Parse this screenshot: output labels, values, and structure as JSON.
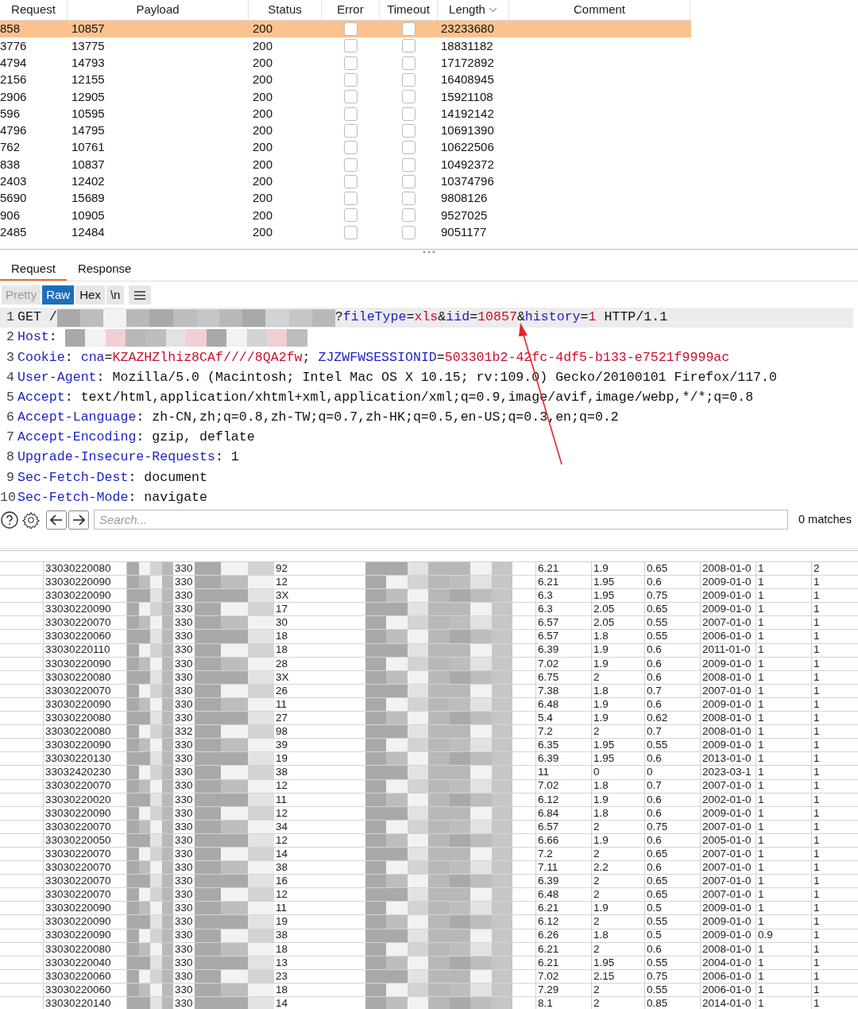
{
  "results_table": {
    "columns": [
      {
        "label": "Request",
        "sorted": false
      },
      {
        "label": "Payload",
        "sorted": false
      },
      {
        "label": "Status",
        "sorted": false
      },
      {
        "label": "Error",
        "sorted": false
      },
      {
        "label": "Timeout",
        "sorted": false
      },
      {
        "label": "Length",
        "sorted": true
      },
      {
        "label": "Comment",
        "sorted": false
      }
    ],
    "rows": [
      {
        "cells": [
          "858",
          "10857",
          "200",
          "23233680"
        ],
        "error": false,
        "timeout": false,
        "selected": true
      },
      {
        "cells": [
          "3776",
          "13775",
          "200",
          "18831182"
        ],
        "error": false,
        "timeout": false,
        "selected": false
      },
      {
        "cells": [
          "4794",
          "14793",
          "200",
          "17172892"
        ],
        "error": false,
        "timeout": false,
        "selected": false
      },
      {
        "cells": [
          "2156",
          "12155",
          "200",
          "16408945"
        ],
        "error": false,
        "timeout": false,
        "selected": false
      },
      {
        "cells": [
          "2906",
          "12905",
          "200",
          "15921108"
        ],
        "error": false,
        "timeout": false,
        "selected": false
      },
      {
        "cells": [
          "596",
          "10595",
          "200",
          "14192142"
        ],
        "error": false,
        "timeout": false,
        "selected": false
      },
      {
        "cells": [
          "4796",
          "14795",
          "200",
          "10691390"
        ],
        "error": false,
        "timeout": false,
        "selected": false
      },
      {
        "cells": [
          "762",
          "10761",
          "200",
          "10622506"
        ],
        "error": false,
        "timeout": false,
        "selected": false
      },
      {
        "cells": [
          "838",
          "10837",
          "200",
          "10492372"
        ],
        "error": false,
        "timeout": false,
        "selected": false
      },
      {
        "cells": [
          "2403",
          "12402",
          "200",
          "10374796"
        ],
        "error": false,
        "timeout": false,
        "selected": false
      },
      {
        "cells": [
          "5690",
          "15689",
          "200",
          "9808126"
        ],
        "error": false,
        "timeout": false,
        "selected": false
      },
      {
        "cells": [
          "906",
          "10905",
          "200",
          "9527025"
        ],
        "error": false,
        "timeout": false,
        "selected": false
      },
      {
        "cells": [
          "2485",
          "12484",
          "200",
          "9051177"
        ],
        "error": false,
        "timeout": false,
        "selected": false
      }
    ]
  },
  "message_tabs": [
    {
      "label": "Request",
      "selected": true
    },
    {
      "label": "Response",
      "selected": false
    }
  ],
  "view_buttons": [
    {
      "kind": "text",
      "label": "Pretty",
      "selected": false
    },
    {
      "kind": "text",
      "label": "Raw",
      "selected": true
    },
    {
      "kind": "text",
      "label": "Hex",
      "selected": false
    },
    {
      "kind": "text",
      "label": "\\n",
      "selected": false
    },
    {
      "kind": "menu",
      "selected": false
    }
  ],
  "request_lines": [
    {
      "number": "1",
      "highlighted": true,
      "segments": [
        {
          "kind": "plain",
          "text": "GET /"
        },
        {
          "kind": "redacted"
        },
        {
          "kind": "plain",
          "text": "?"
        },
        {
          "kind": "name",
          "text": "fileType"
        },
        {
          "kind": "plain",
          "text": "="
        },
        {
          "kind": "value",
          "text": "xls"
        },
        {
          "kind": "plain",
          "text": "&"
        },
        {
          "kind": "name",
          "text": "iid"
        },
        {
          "kind": "plain",
          "text": "="
        },
        {
          "kind": "value",
          "text": "10857"
        },
        {
          "kind": "plain",
          "text": "&"
        },
        {
          "kind": "name",
          "text": "history"
        },
        {
          "kind": "plain",
          "text": "="
        },
        {
          "kind": "value",
          "text": "1"
        },
        {
          "kind": "plain",
          "text": " HTTP/1.1"
        }
      ]
    },
    {
      "number": "2",
      "highlighted": false,
      "segments": [
        {
          "kind": "name",
          "text": "Host"
        },
        {
          "kind": "plain",
          "text": ": "
        },
        {
          "kind": "redacted"
        }
      ]
    },
    {
      "number": "3",
      "highlighted": false,
      "segments": [
        {
          "kind": "name",
          "text": "Cookie"
        },
        {
          "kind": "plain",
          "text": ": "
        },
        {
          "kind": "name",
          "text": "cna"
        },
        {
          "kind": "plain",
          "text": "="
        },
        {
          "kind": "value",
          "text": "KZAZHZlhiz8CAf////8QA2fw"
        },
        {
          "kind": "plain",
          "text": "; "
        },
        {
          "kind": "name",
          "text": "ZJZWFWSESSIONID"
        },
        {
          "kind": "plain",
          "text": "="
        },
        {
          "kind": "value",
          "text": "503301b2-42fc-4df5-b133-e7521f9999ac"
        }
      ]
    },
    {
      "number": "4",
      "highlighted": false,
      "segments": [
        {
          "kind": "name",
          "text": "User-Agent"
        },
        {
          "kind": "plain",
          "text": ": Mozilla/5.0 (Macintosh; Intel Mac OS X 10.15; rv:109.0) Gecko/20100101 Firefox/117.0"
        }
      ]
    },
    {
      "number": "5",
      "highlighted": false,
      "segments": [
        {
          "kind": "name",
          "text": "Accept"
        },
        {
          "kind": "plain",
          "text": ": text/html,application/xhtml+xml,application/xml;q=0.9,image/avif,image/webp,*/*;q=0.8"
        }
      ]
    },
    {
      "number": "6",
      "highlighted": false,
      "segments": [
        {
          "kind": "name",
          "text": "Accept-Language"
        },
        {
          "kind": "plain",
          "text": ": zh-CN,zh;q=0.8,zh-TW;q=0.7,zh-HK;q=0.5,en-US;q=0.3,en;q=0.2"
        }
      ]
    },
    {
      "number": "7",
      "highlighted": false,
      "segments": [
        {
          "kind": "name",
          "text": "Accept-Encoding"
        },
        {
          "kind": "plain",
          "text": ": gzip, deflate"
        }
      ]
    },
    {
      "number": "8",
      "highlighted": false,
      "segments": [
        {
          "kind": "name",
          "text": "Upgrade-Insecure-Requests"
        },
        {
          "kind": "plain",
          "text": ": 1"
        }
      ]
    },
    {
      "number": "9",
      "highlighted": false,
      "segments": [
        {
          "kind": "name",
          "text": "Sec-Fetch-Dest"
        },
        {
          "kind": "plain",
          "text": ": document"
        }
      ]
    },
    {
      "number": "10",
      "highlighted": false,
      "segments": [
        {
          "kind": "name",
          "text": "Sec-Fetch-Mode"
        },
        {
          "kind": "plain",
          "text": ": navigate"
        }
      ]
    }
  ],
  "search": {
    "placeholder": "Search...",
    "matches": "0 matches"
  },
  "spreadsheet_rows": [
    [
      "33030220080",
      "330",
      "92",
      "6.21",
      "1.9",
      "0.65",
      "2008-01-0",
      "1",
      "2"
    ],
    [
      "33030220090",
      "330",
      "12",
      "6.21",
      "1.95",
      "0.6",
      "2009-01-0",
      "1",
      "1"
    ],
    [
      "33030220090",
      "330",
      "3X",
      "6.3",
      "1.95",
      "0.75",
      "2009-01-0",
      "1",
      "1"
    ],
    [
      "33030220090",
      "330",
      "17",
      "6.3",
      "2.05",
      "0.65",
      "2009-01-0",
      "1",
      "1"
    ],
    [
      "33030220070",
      "330",
      "30",
      "6.57",
      "2.05",
      "0.55",
      "2007-01-0",
      "1",
      "1"
    ],
    [
      "33030220060",
      "330",
      "18",
      "6.57",
      "1.8",
      "0.55",
      "2006-01-0",
      "1",
      "1"
    ],
    [
      "33030220110",
      "330",
      "18",
      "6.39",
      "1.9",
      "0.6",
      "2011-01-0",
      "1",
      "1"
    ],
    [
      "33030220090",
      "330",
      "28",
      "7.02",
      "1.9",
      "0.6",
      "2009-01-0",
      "1",
      "1"
    ],
    [
      "33030220080",
      "330",
      "3X",
      "6.75",
      "2",
      "0.6",
      "2008-01-0",
      "1",
      "1"
    ],
    [
      "33030220070",
      "330",
      "26",
      "7.38",
      "1.8",
      "0.7",
      "2007-01-0",
      "1",
      "1"
    ],
    [
      "33030220090",
      "330",
      "11",
      "6.48",
      "1.9",
      "0.6",
      "2009-01-0",
      "1",
      "1"
    ],
    [
      "33030220080",
      "330",
      "27",
      "5.4",
      "1.9",
      "0.62",
      "2008-01-0",
      "1",
      "1"
    ],
    [
      "33030220080",
      "332",
      "98",
      "7.2",
      "2",
      "0.7",
      "2008-01-0",
      "1",
      "1"
    ],
    [
      "33030220090",
      "330",
      "39",
      "6.35",
      "1.95",
      "0.55",
      "2009-01-0",
      "1",
      "1"
    ],
    [
      "33030220130",
      "330",
      "19",
      "6.39",
      "1.95",
      "0.6",
      "2013-01-0",
      "1",
      "1"
    ],
    [
      "33032420230",
      "330",
      "38",
      "11",
      "0",
      "0",
      "2023-03-1",
      "1",
      "1"
    ],
    [
      "33030220070",
      "330",
      "12",
      "7.02",
      "1.8",
      "0.7",
      "2007-01-0",
      "1",
      "1"
    ],
    [
      "33030220020",
      "330",
      "11",
      "6.12",
      "1.9",
      "0.6",
      "2002-01-0",
      "1",
      "1"
    ],
    [
      "33030220090",
      "330",
      "12",
      "6.84",
      "1.8",
      "0.6",
      "2009-01-0",
      "1",
      "1"
    ],
    [
      "33030220070",
      "330",
      "34",
      "6.57",
      "2",
      "0.75",
      "2007-01-0",
      "1",
      "1"
    ],
    [
      "33030220050",
      "330",
      "12",
      "6.66",
      "1.9",
      "0.6",
      "2005-01-0",
      "1",
      "1"
    ],
    [
      "33030220070",
      "330",
      "14",
      "7.2",
      "2",
      "0.65",
      "2007-01-0",
      "1",
      "1"
    ],
    [
      "33030220070",
      "330",
      "38",
      "7.11",
      "2.2",
      "0.6",
      "2007-01-0",
      "1",
      "1"
    ],
    [
      "33030220070",
      "330",
      "16",
      "6.39",
      "2",
      "0.65",
      "2007-01-0",
      "1",
      "1"
    ],
    [
      "33030220070",
      "330",
      "12",
      "6.48",
      "2",
      "0.65",
      "2007-01-0",
      "1",
      "1"
    ],
    [
      "33030220090",
      "330",
      "11",
      "6.21",
      "1.9",
      "0.5",
      "2009-01-0",
      "1",
      "1"
    ],
    [
      "33030220090",
      "330",
      "19",
      "6.12",
      "2",
      "0.55",
      "2009-01-0",
      "1",
      "1"
    ],
    [
      "33030220090",
      "330",
      "38",
      "6.26",
      "1.8",
      "0.5",
      "2009-01-0",
      "0.9",
      "1"
    ],
    [
      "33030220080",
      "330",
      "18",
      "6.21",
      "2",
      "0.6",
      "2008-01-0",
      "1",
      "1"
    ],
    [
      "33030220040",
      "330",
      "13",
      "6.21",
      "1.95",
      "0.55",
      "2004-01-0",
      "1",
      "1"
    ],
    [
      "33030220060",
      "330",
      "23",
      "7.02",
      "2.15",
      "0.75",
      "2006-01-0",
      "1",
      "1"
    ],
    [
      "33030220060",
      "330",
      "18",
      "7.29",
      "2",
      "0.55",
      "2006-01-0",
      "1",
      "1"
    ],
    [
      "33030220140",
      "330",
      "14",
      "8.1",
      "2",
      "0.85",
      "2014-01-0",
      "1",
      "1"
    ]
  ]
}
